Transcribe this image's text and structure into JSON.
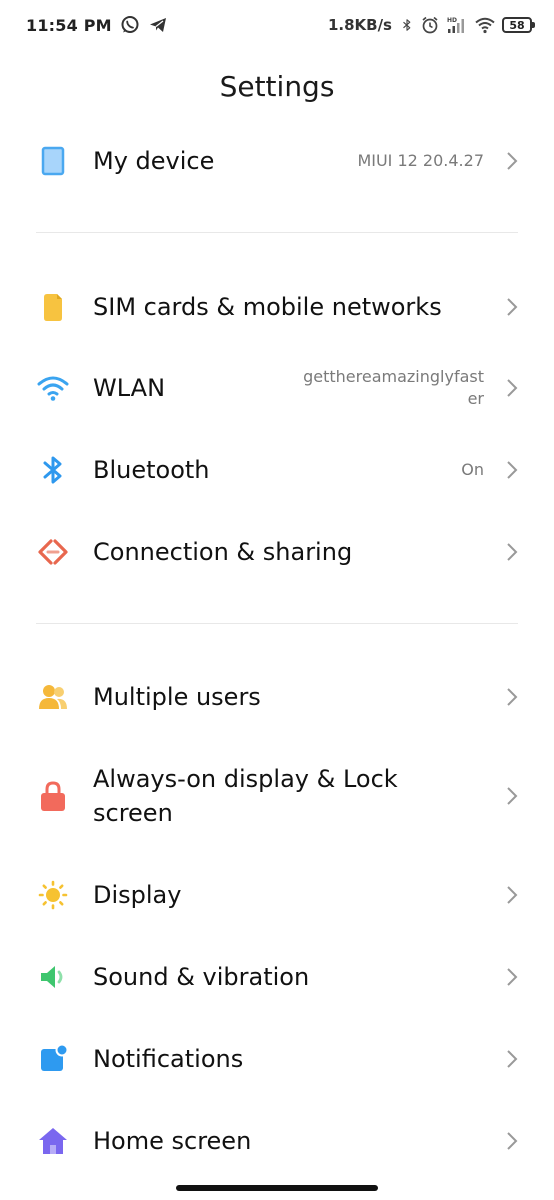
{
  "status_bar": {
    "time": "11:54 PM",
    "net_speed": "1.8KB/s",
    "battery": "58"
  },
  "title": "Settings",
  "my_device": {
    "label": "My device",
    "value": "MIUI 12 20.4.27"
  },
  "sim": {
    "label": "SIM cards & mobile networks"
  },
  "wlan": {
    "label": "WLAN",
    "value_line1": "getthereamazinglyfast",
    "value_line2": "er"
  },
  "bluetooth": {
    "label": "Bluetooth",
    "value": "On"
  },
  "connection": {
    "label": "Connection & sharing"
  },
  "users": {
    "label": "Multiple users"
  },
  "lock": {
    "label": "Always-on display & Lock screen"
  },
  "display": {
    "label": "Display"
  },
  "sound": {
    "label": "Sound & vibration"
  },
  "notifications": {
    "label": "Notifications"
  },
  "home": {
    "label": "Home screen"
  },
  "colors": {
    "device_icon": "#4aa8f0",
    "sim_icon": "#f7c340",
    "wifi_icon": "#3aa4f0",
    "bluetooth_icon": "#2e98ee",
    "connection_icon": "#e8674e",
    "users_icon": "#f5b83a",
    "lock_icon": "#f26a5c",
    "display_icon": "#f6c231",
    "sound_icon": "#3ec66e",
    "notifications_icon": "#2e9af0",
    "home_icon": "#7a67ef"
  }
}
